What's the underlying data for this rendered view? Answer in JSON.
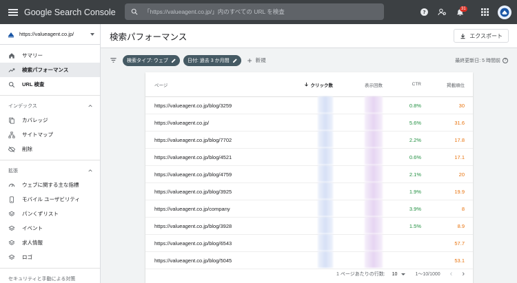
{
  "app": {
    "title": "Google Search Console",
    "search_placeholder": "「https://valueagent.co.jp/」内のすべての URL を検査",
    "notification_count": "31"
  },
  "sidebar": {
    "property": "https://valueagent.co.jp/",
    "items_top": [
      {
        "label": "サマリー",
        "icon": "home-icon"
      },
      {
        "label": "検索パフォーマンス",
        "icon": "trending-up-icon",
        "active": true
      },
      {
        "label": "URL 検査",
        "icon": "search-icon"
      }
    ],
    "section_index": {
      "title": "インデックス",
      "items": [
        {
          "label": "カバレッジ",
          "icon": "coverage-icon"
        },
        {
          "label": "サイトマップ",
          "icon": "sitemap-icon"
        },
        {
          "label": "削除",
          "icon": "removal-icon"
        }
      ]
    },
    "section_enhancements": {
      "title": "拡張",
      "items": [
        {
          "label": "ウェブに関する主な指標",
          "icon": "gauge-icon"
        },
        {
          "label": "モバイル ユーザビリティ",
          "icon": "mobile-icon"
        },
        {
          "label": "パンくずリスト",
          "icon": "layers-icon"
        },
        {
          "label": "イベント",
          "icon": "layers-icon"
        },
        {
          "label": "求人情報",
          "icon": "layers-icon"
        },
        {
          "label": "ロゴ",
          "icon": "layers-icon"
        }
      ]
    },
    "section_security": {
      "title": "セキュリティと手動による対策"
    }
  },
  "header": {
    "title": "検索パフォーマンス",
    "export_label": "エクスポート"
  },
  "filters": {
    "chips": [
      {
        "label": "検索タイプ: ウェブ"
      },
      {
        "label": "日付: 過去 3 か月間"
      }
    ],
    "new_label": "新規",
    "last_updated": "最終更新日: 5 時間前"
  },
  "table": {
    "headers": {
      "page": "ページ",
      "clicks": "クリック数",
      "impressions": "表示回数",
      "ctr": "CTR",
      "position": "掲載順位"
    },
    "rows": [
      {
        "page": "https://valueagent.co.jp/blog/3259",
        "ctr": "0.8%",
        "position": "30"
      },
      {
        "page": "https://valueagent.co.jp/",
        "ctr": "5.6%",
        "position": "31.6"
      },
      {
        "page": "https://valueagent.co.jp/blog/7702",
        "ctr": "2.2%",
        "position": "17.8"
      },
      {
        "page": "https://valueagent.co.jp/blog/4521",
        "ctr": "0.6%",
        "position": "17.1"
      },
      {
        "page": "https://valueagent.co.jp/blog/4759",
        "ctr": "2.1%",
        "position": "20"
      },
      {
        "page": "https://valueagent.co.jp/blog/3925",
        "ctr": "1.9%",
        "position": "19.9"
      },
      {
        "page": "https://valueagent.co.jp/company",
        "ctr": "3.9%",
        "position": "8"
      },
      {
        "page": "https://valueagent.co.jp/blog/3928",
        "ctr": "1.5%",
        "position": "8.9"
      },
      {
        "page": "https://valueagent.co.jp/blog/6543",
        "ctr": "",
        "position": "57.7"
      },
      {
        "page": "https://valueagent.co.jp/blog/5045",
        "ctr": "",
        "position": "53.1"
      }
    ],
    "footer": {
      "rows_per_page_label": "1 ページあたりの行数:",
      "rows_per_page": "10",
      "range": "1〜10/1000"
    }
  },
  "colors": {
    "topbar": "#3c4043",
    "chip": "#455a64",
    "ctr": "#1e8e3e",
    "position": "#e8710a",
    "badge": "#d93025"
  }
}
